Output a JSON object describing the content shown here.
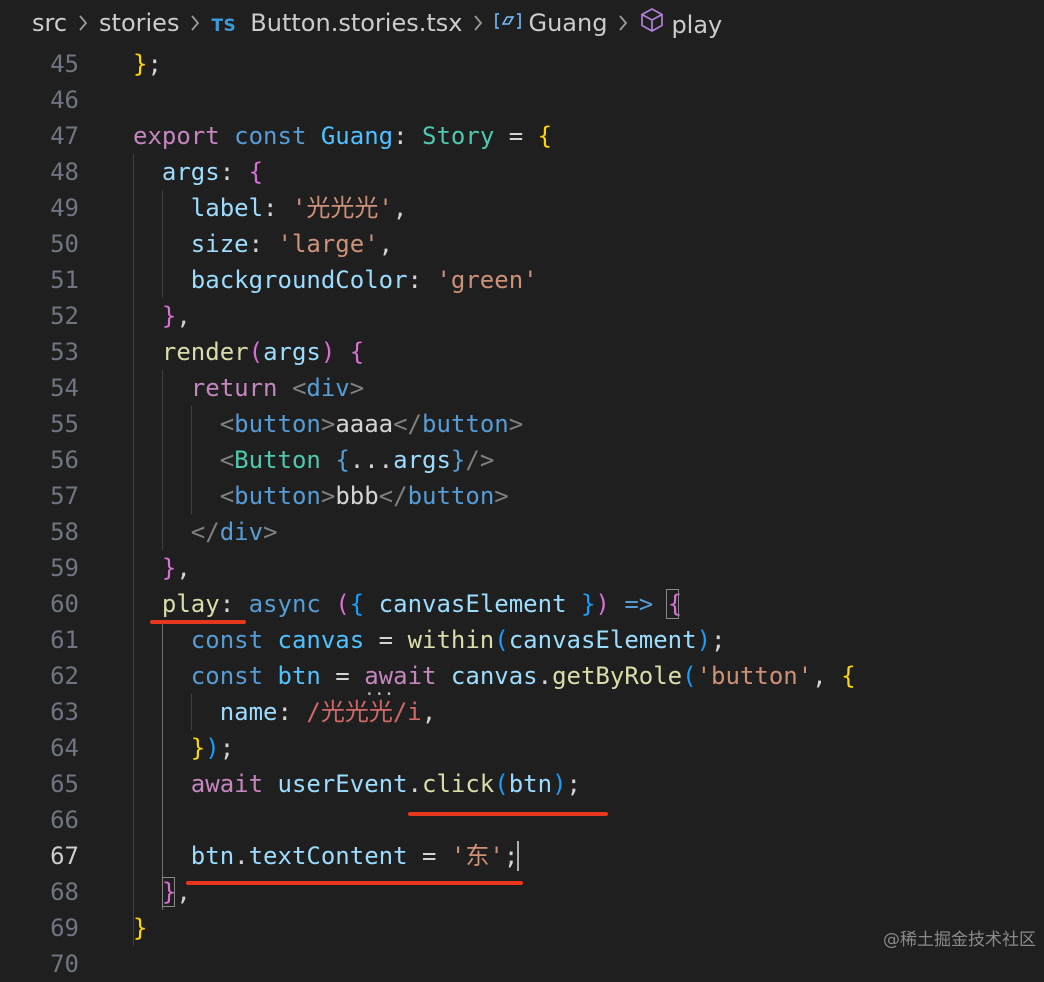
{
  "breadcrumb": {
    "folder1": "src",
    "folder2": "stories",
    "file_badge": "TS",
    "file": "Button.stories.tsx",
    "symbol": "Guang",
    "member": "play"
  },
  "lines": [
    {
      "n": "45",
      "tokens": [
        [
          "b1",
          "}"
        ],
        [
          "op",
          ";"
        ]
      ]
    },
    {
      "n": "46",
      "tokens": []
    },
    {
      "n": "47",
      "tokens": [
        [
          "kw",
          "export"
        ],
        [
          "op",
          " "
        ],
        [
          "kwb",
          "const"
        ],
        [
          "op",
          " "
        ],
        [
          "cst",
          "Guang"
        ],
        [
          "op",
          ": "
        ],
        [
          "typ",
          "Story"
        ],
        [
          "op",
          " = "
        ],
        [
          "b1",
          "{"
        ]
      ]
    },
    {
      "n": "48",
      "tokens": [
        [
          "op",
          "  "
        ],
        [
          "var",
          "args"
        ],
        [
          "op",
          ": "
        ],
        [
          "b2",
          "{"
        ]
      ]
    },
    {
      "n": "49",
      "tokens": [
        [
          "op",
          "    "
        ],
        [
          "var",
          "label"
        ],
        [
          "op",
          ": "
        ],
        [
          "str",
          "'光光光'"
        ],
        [
          "op",
          ","
        ]
      ]
    },
    {
      "n": "50",
      "tokens": [
        [
          "op",
          "    "
        ],
        [
          "var",
          "size"
        ],
        [
          "op",
          ": "
        ],
        [
          "str",
          "'large'"
        ],
        [
          "op",
          ","
        ]
      ]
    },
    {
      "n": "51",
      "tokens": [
        [
          "op",
          "    "
        ],
        [
          "var",
          "backgroundColor"
        ],
        [
          "op",
          ": "
        ],
        [
          "str",
          "'green'"
        ]
      ]
    },
    {
      "n": "52",
      "tokens": [
        [
          "op",
          "  "
        ],
        [
          "b2",
          "}"
        ],
        [
          "op",
          ","
        ]
      ]
    },
    {
      "n": "53",
      "tokens": [
        [
          "op",
          "  "
        ],
        [
          "fn",
          "render"
        ],
        [
          "b2",
          "("
        ],
        [
          "var",
          "args"
        ],
        [
          "b2",
          ")"
        ],
        [
          "op",
          " "
        ],
        [
          "b2",
          "{"
        ]
      ]
    },
    {
      "n": "54",
      "tokens": [
        [
          "op",
          "    "
        ],
        [
          "kw",
          "return"
        ],
        [
          "op",
          " "
        ],
        [
          "tag",
          "<"
        ],
        [
          "tn",
          "div"
        ],
        [
          "tag",
          ">"
        ]
      ]
    },
    {
      "n": "55",
      "tokens": [
        [
          "op",
          "      "
        ],
        [
          "tag",
          "<"
        ],
        [
          "tn",
          "button"
        ],
        [
          "tag",
          ">"
        ],
        [
          "op",
          "aaaa"
        ],
        [
          "tag",
          "</"
        ],
        [
          "tn",
          "button"
        ],
        [
          "tag",
          ">"
        ]
      ]
    },
    {
      "n": "56",
      "tokens": [
        [
          "op",
          "      "
        ],
        [
          "tag",
          "<"
        ],
        [
          "typ",
          "Button"
        ],
        [
          "op",
          " "
        ],
        [
          "kwb",
          "{"
        ],
        [
          "op",
          "..."
        ],
        [
          "var",
          "args"
        ],
        [
          "kwb",
          "}"
        ],
        [
          "tag",
          "/>"
        ]
      ]
    },
    {
      "n": "57",
      "tokens": [
        [
          "op",
          "      "
        ],
        [
          "tag",
          "<"
        ],
        [
          "tn",
          "button"
        ],
        [
          "tag",
          ">"
        ],
        [
          "op",
          "bbb"
        ],
        [
          "tag",
          "</"
        ],
        [
          "tn",
          "button"
        ],
        [
          "tag",
          ">"
        ]
      ]
    },
    {
      "n": "58",
      "tokens": [
        [
          "op",
          "    "
        ],
        [
          "tag",
          "</"
        ],
        [
          "tn",
          "div"
        ],
        [
          "tag",
          ">"
        ]
      ]
    },
    {
      "n": "59",
      "tokens": [
        [
          "op",
          "  "
        ],
        [
          "b2",
          "}"
        ],
        [
          "op",
          ","
        ]
      ]
    },
    {
      "n": "60",
      "tokens": [
        [
          "op",
          "  "
        ],
        [
          "fn",
          "play"
        ],
        [
          "op",
          ": "
        ],
        [
          "kwb",
          "async"
        ],
        [
          "op",
          " "
        ],
        [
          "b2",
          "("
        ],
        [
          "b3",
          "{"
        ],
        [
          "op",
          " "
        ],
        [
          "var",
          "canvasElement"
        ],
        [
          "op",
          " "
        ],
        [
          "b3",
          "}"
        ],
        [
          "b2",
          ")"
        ],
        [
          "op",
          " "
        ],
        [
          "kwb",
          "=>"
        ],
        [
          "op",
          " "
        ],
        [
          "b2",
          "{"
        ]
      ]
    },
    {
      "n": "61",
      "tokens": [
        [
          "op",
          "    "
        ],
        [
          "kwb",
          "const"
        ],
        [
          "op",
          " "
        ],
        [
          "cst",
          "canvas"
        ],
        [
          "op",
          " = "
        ],
        [
          "fn",
          "within"
        ],
        [
          "b3",
          "("
        ],
        [
          "var",
          "canvasElement"
        ],
        [
          "b3",
          ")"
        ],
        [
          "op",
          ";"
        ]
      ]
    },
    {
      "n": "62",
      "tokens": [
        [
          "op",
          "    "
        ],
        [
          "kwb",
          "const"
        ],
        [
          "op",
          " "
        ],
        [
          "cst",
          "btn"
        ],
        [
          "op",
          " = "
        ],
        [
          "kw",
          "await"
        ],
        [
          "op",
          " "
        ],
        [
          "var",
          "canvas"
        ],
        [
          "op",
          "."
        ],
        [
          "fn",
          "getByRole"
        ],
        [
          "b3",
          "("
        ],
        [
          "str",
          "'button'"
        ],
        [
          "op",
          ", "
        ],
        [
          "b1",
          "{"
        ]
      ]
    },
    {
      "n": "63",
      "tokens": [
        [
          "op",
          "      "
        ],
        [
          "var",
          "name"
        ],
        [
          "op",
          ": "
        ],
        [
          "rx",
          "/光光光/i"
        ],
        [
          "op",
          ","
        ]
      ]
    },
    {
      "n": "64",
      "tokens": [
        [
          "op",
          "    "
        ],
        [
          "b1",
          "}"
        ],
        [
          "b3",
          ")"
        ],
        [
          "op",
          ";"
        ]
      ]
    },
    {
      "n": "65",
      "tokens": [
        [
          "op",
          "    "
        ],
        [
          "kw",
          "await"
        ],
        [
          "op",
          " "
        ],
        [
          "var",
          "userEvent"
        ],
        [
          "op",
          "."
        ],
        [
          "fn",
          "click"
        ],
        [
          "b3",
          "("
        ],
        [
          "var",
          "btn"
        ],
        [
          "b3",
          ")"
        ],
        [
          "op",
          ";"
        ]
      ]
    },
    {
      "n": "66",
      "tokens": []
    },
    {
      "n": "67",
      "tokens": [
        [
          "op",
          "    "
        ],
        [
          "var",
          "btn"
        ],
        [
          "op",
          "."
        ],
        [
          "var",
          "textContent"
        ],
        [
          "op",
          " = "
        ],
        [
          "str",
          "'东'"
        ],
        [
          "op",
          ";"
        ]
      ]
    },
    {
      "n": "68",
      "tokens": [
        [
          "op",
          "  "
        ],
        [
          "b2",
          "}"
        ],
        [
          "op",
          ","
        ]
      ]
    },
    {
      "n": "69",
      "tokens": [
        [
          "b1",
          "}"
        ]
      ]
    },
    {
      "n": "70",
      "tokens": []
    }
  ],
  "active_line": "67",
  "watermark": "@稀土掘金技术社区"
}
